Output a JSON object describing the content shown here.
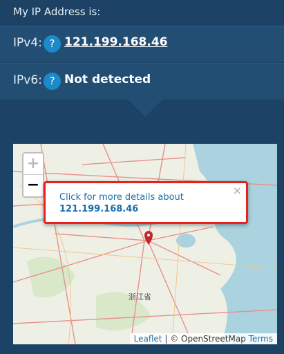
{
  "header": {
    "title": "My IP Address is:"
  },
  "ipv4": {
    "label": "IPv4:",
    "help": "?",
    "value": "121.199.168.46"
  },
  "ipv6": {
    "label": "IPv6:",
    "help": "?",
    "value": "Not detected"
  },
  "map": {
    "zoom_in": "+",
    "zoom_out": "−",
    "province_label": "浙江省",
    "popup": {
      "text": "Click for more details about",
      "ip": "121.199.168.46",
      "close": "×"
    },
    "attribution": {
      "leaflet": "Leaflet",
      "separator": " | © OpenStreetMap ",
      "terms": "Terms"
    }
  },
  "colors": {
    "background": "#1c4366",
    "row": "#234e74",
    "help_badge": "#1a8ac8",
    "popup_border": "#e8221b",
    "marker": "#c3262b"
  }
}
